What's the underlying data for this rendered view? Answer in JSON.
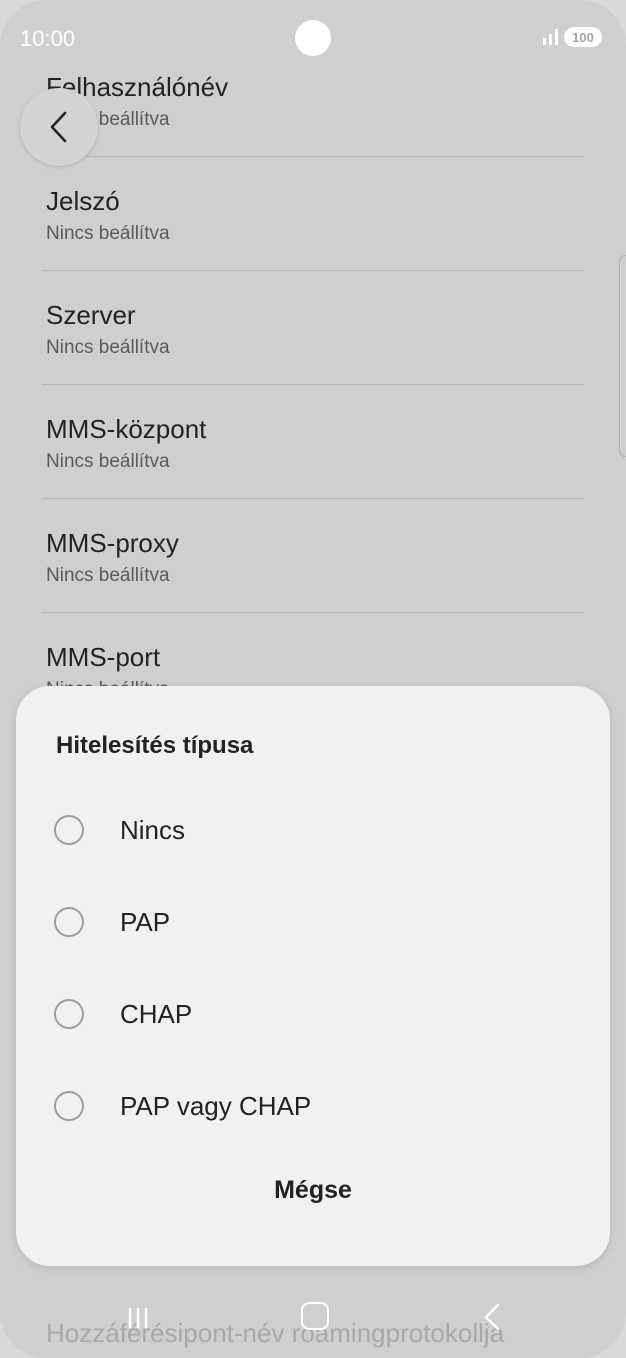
{
  "status_bar": {
    "time": "10:00",
    "battery": "100"
  },
  "list": {
    "items": [
      {
        "title": "Felhasználónév",
        "subtitle": "Nincs beállítva"
      },
      {
        "title": "Jelszó",
        "subtitle": "Nincs beállítva"
      },
      {
        "title": "Szerver",
        "subtitle": "Nincs beállítva"
      },
      {
        "title": "MMS-központ",
        "subtitle": "Nincs beállítva"
      },
      {
        "title": "MMS-proxy",
        "subtitle": "Nincs beállítva"
      },
      {
        "title": "MMS-port",
        "subtitle": "Nincs beállítva"
      }
    ],
    "bottom_item": "Hozzáférésipont-név roamingprotokollja"
  },
  "dialog": {
    "title": "Hitelesítés típusa",
    "options": [
      "Nincs",
      "PAP",
      "CHAP",
      "PAP vagy CHAP"
    ],
    "cancel_label": "Mégse"
  }
}
